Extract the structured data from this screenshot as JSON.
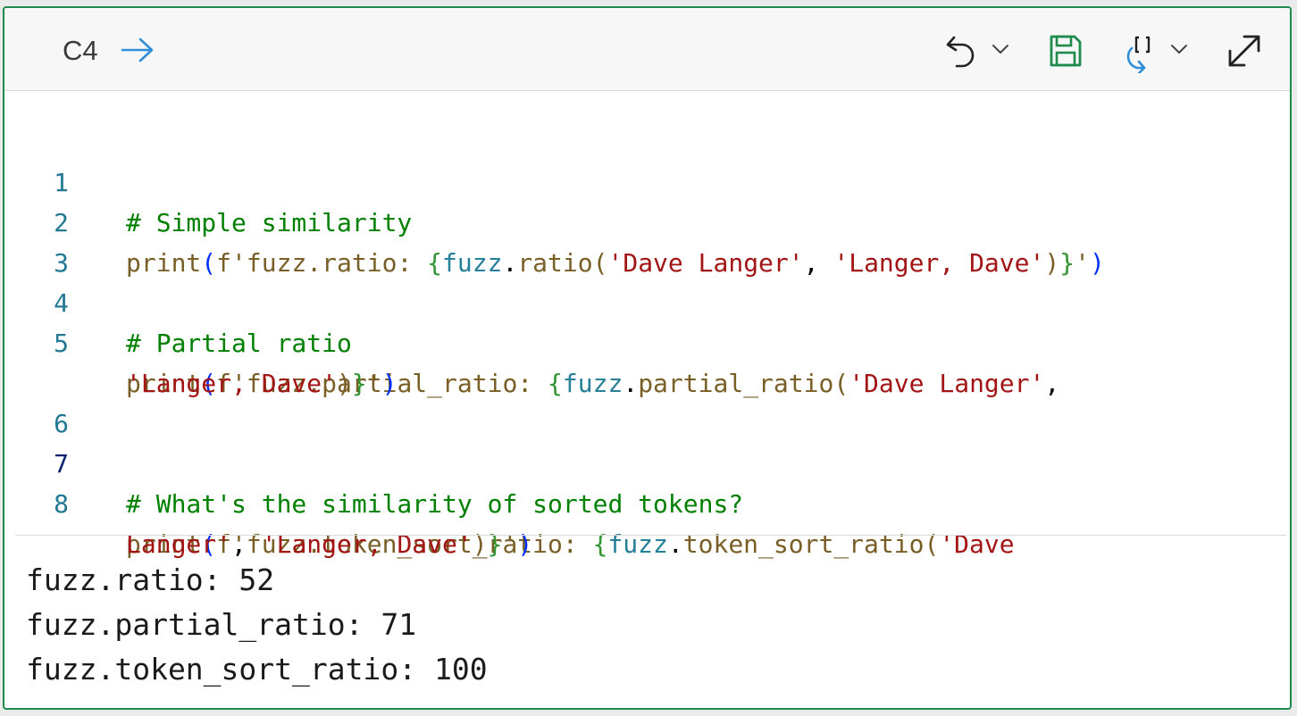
{
  "cell": {
    "ref": "C4",
    "icons": [
      "arrow-right-icon",
      "undo-icon",
      "chevron-down-icon",
      "save-icon",
      "refresh-range-icon",
      "chevron-down-icon",
      "expand-icon"
    ]
  },
  "code": {
    "lines": [
      {
        "num": "1",
        "parts": [
          "# Simple similarity"
        ]
      },
      {
        "num": "2",
        "parts": [
          "print",
          "(",
          "f'fuzz.ratio: ",
          "{",
          "fuzz",
          ".",
          "ratio",
          "(",
          "'Dave Langer'",
          ", ",
          "'Langer, Dave'",
          ")",
          "}",
          "'",
          ")"
        ]
      },
      {
        "num": "3",
        "parts": []
      },
      {
        "num": "4",
        "parts": [
          "# Partial ratio"
        ]
      },
      {
        "num": "5",
        "parts": [
          "print",
          "(",
          "f'fuzz.partial_ratio: ",
          "{",
          "fuzz",
          ".",
          "partial_ratio",
          "(",
          "'Dave Langer'",
          ","
        ]
      },
      {
        "num": "",
        "parts": [
          "'Langer, Dave'",
          ")",
          "}",
          "'",
          ")"
        ]
      },
      {
        "num": "6",
        "parts": []
      },
      {
        "num": "7",
        "parts": [
          "# What's the similarity of sorted tokens?"
        ]
      },
      {
        "num": "8",
        "parts": [
          "print",
          "(",
          "f'fuzz.token_sort_ratio: ",
          "{",
          "fuzz",
          ".",
          "token_sort_ratio",
          "(",
          "'Dave"
        ]
      },
      {
        "num": "",
        "parts": [
          "Langer'",
          ", ",
          "'Langer, Dave'",
          ")",
          "}",
          "'",
          ")"
        ]
      }
    ]
  },
  "output": {
    "lines": [
      "fuzz.ratio: 52",
      "fuzz.partial_ratio: 71",
      "fuzz.token_sort_ratio: 100"
    ]
  },
  "colors": {
    "border": "#1e8a4c",
    "comment": "#008000",
    "function": "#795e26",
    "string": "#a31515",
    "variable": "#267f99",
    "paren": "#0431fa",
    "brace": "#319331",
    "line_number": "#237893",
    "save_icon": "#1e8a4c",
    "refresh_icon": "#2f8fd8"
  }
}
